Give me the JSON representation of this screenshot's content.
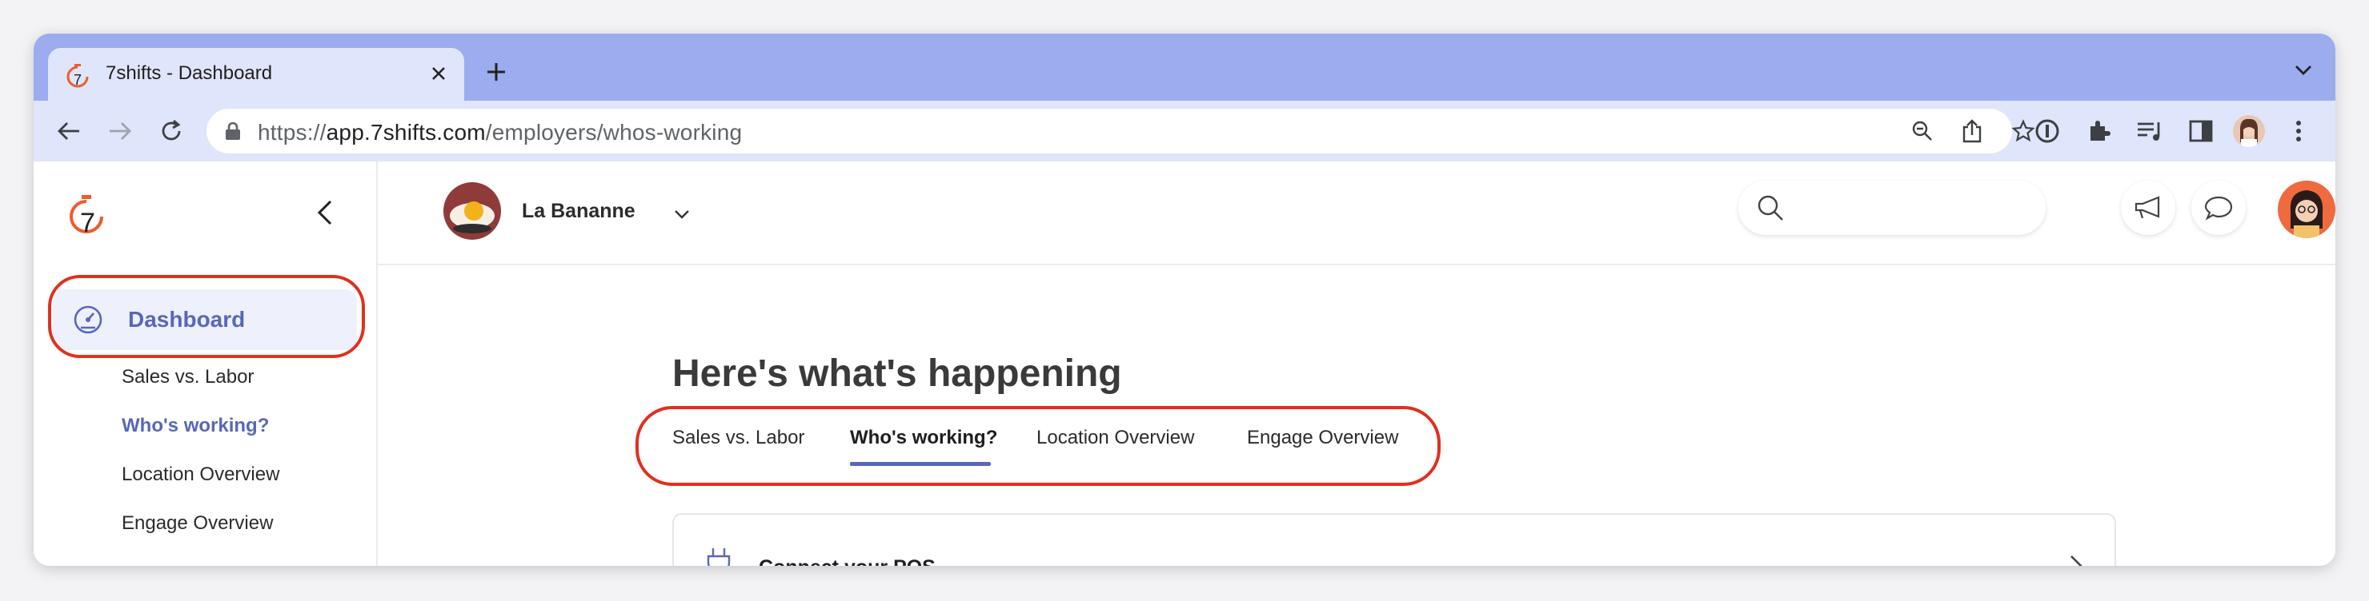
{
  "browser": {
    "tab_title": "7shifts - Dashboard",
    "url_scheme": "https://",
    "url_host": "app.7shifts.com",
    "url_path": "/employers/whos-working"
  },
  "sidebar": {
    "logo_text": "7",
    "dashboard_label": "Dashboard",
    "sub_items": [
      {
        "label": "Sales vs. Labor",
        "active": false
      },
      {
        "label": "Who's working?",
        "active": true
      },
      {
        "label": "Location Overview",
        "active": false
      },
      {
        "label": "Engage Overview",
        "active": false
      }
    ]
  },
  "topbar": {
    "location_name": "La Bananne",
    "search_placeholder": ""
  },
  "main": {
    "heading": "Here's what's happening",
    "tabs": [
      {
        "label": "Sales vs. Labor",
        "active": false
      },
      {
        "label": "Who's working?",
        "active": true
      },
      {
        "label": "Location Overview",
        "active": false
      },
      {
        "label": "Engage Overview",
        "active": false
      }
    ],
    "card_label": "Connect your POS"
  },
  "colors": {
    "accent": "#5867b8",
    "highlight": "#e0301e",
    "brand_orange": "#ef5b2f",
    "tabstrip": "#9badef"
  },
  "icons": {
    "tab_favicon": "7shifts-logo-icon",
    "close": "close-icon",
    "new_tab": "plus-icon",
    "back": "arrow-left-icon",
    "forward": "arrow-right-icon",
    "reload": "reload-icon",
    "lock": "lock-icon",
    "zoom": "zoom-out-icon",
    "share": "share-icon",
    "bookmark": "star-icon",
    "search": "search-icon",
    "announcements": "megaphone-icon",
    "messages": "chat-bubble-icon",
    "dashboard": "speedometer-icon",
    "pos": "plug-icon",
    "chevron": "chevron-right-icon"
  }
}
